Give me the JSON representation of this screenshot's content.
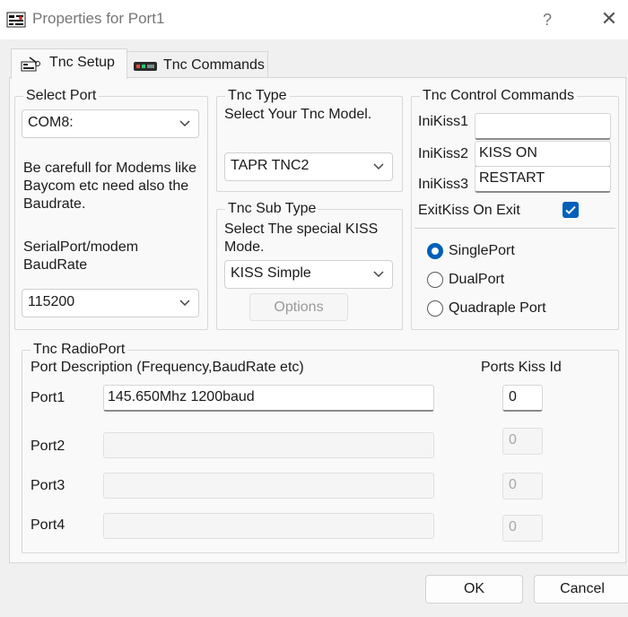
{
  "window": {
    "title": "Properties for Port1",
    "help": "?",
    "close": "✕"
  },
  "tabs": [
    {
      "label": "Tnc Setup",
      "icon": "tnc-setup-icon"
    },
    {
      "label": "Tnc Commands",
      "icon": "tnc-commands-icon"
    }
  ],
  "select_port": {
    "legend": "Select Port",
    "port_value": "COM8:",
    "warning": [
      "Be carefull for Modems like",
      "Baycom etc need also the",
      "Baudrate."
    ],
    "baud_label": [
      "SerialPort/modem",
      "BaudRate"
    ],
    "baud_value": "115200"
  },
  "tnc_type": {
    "legend": "Tnc Type",
    "prompt": "Select Your Tnc Model.",
    "value": "TAPR TNC2"
  },
  "tnc_sub_type": {
    "legend": "Tnc Sub Type",
    "prompt": [
      "Select The special KISS",
      "Mode."
    ],
    "value": "KISS Simple",
    "options_button": "Options"
  },
  "tnc_control": {
    "legend": "Tnc Control Commands",
    "inikiss1_label": "IniKiss1",
    "inikiss1_value": "",
    "inikiss2_label": "IniKiss2",
    "inikiss2_value": "KISS ON",
    "inikiss3_label": "IniKiss3",
    "inikiss3_value": "RESTART",
    "exitkiss_label": "ExitKiss On Exit",
    "exitkiss_checked": true,
    "port_modes": [
      {
        "label": "SinglePort",
        "checked": true
      },
      {
        "label": "DualPort",
        "checked": false
      },
      {
        "label": "Quadraple Port",
        "checked": false
      }
    ]
  },
  "radio_port": {
    "legend": "Tnc RadioPort",
    "desc_header": "Port Description (Frequency,BaudRate etc)",
    "kiss_header": "Ports Kiss Id",
    "ports": [
      {
        "label": "Port1",
        "description": "145.650Mhz 1200baud",
        "kiss_id": "0",
        "enabled": true
      },
      {
        "label": "Port2",
        "description": "",
        "kiss_id": "0",
        "enabled": false
      },
      {
        "label": "Port3",
        "description": "",
        "kiss_id": "0",
        "enabled": false
      },
      {
        "label": "Port4",
        "description": "",
        "kiss_id": "0",
        "enabled": false
      }
    ]
  },
  "buttons": {
    "ok": "OK",
    "cancel": "Cancel"
  },
  "colors": {
    "accent": "#005fb8"
  }
}
